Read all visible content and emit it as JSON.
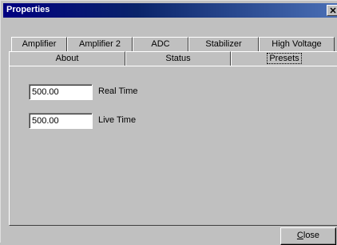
{
  "window": {
    "title": "Properties",
    "close_glyph": "✕"
  },
  "tabs_row1": [
    {
      "label": "Amplifier"
    },
    {
      "label": "Amplifier 2"
    },
    {
      "label": "ADC"
    },
    {
      "label": "Stabilizer"
    },
    {
      "label": "High Voltage"
    }
  ],
  "tabs_row2": [
    {
      "label": "About"
    },
    {
      "label": "Status"
    },
    {
      "label": "Presets",
      "selected": true
    }
  ],
  "presets": {
    "real_time": {
      "value": "500.00",
      "label": "Real Time"
    },
    "live_time": {
      "value": "500.00",
      "label": "Live Time"
    }
  },
  "close_button": {
    "accel": "C",
    "rest": "lose"
  }
}
